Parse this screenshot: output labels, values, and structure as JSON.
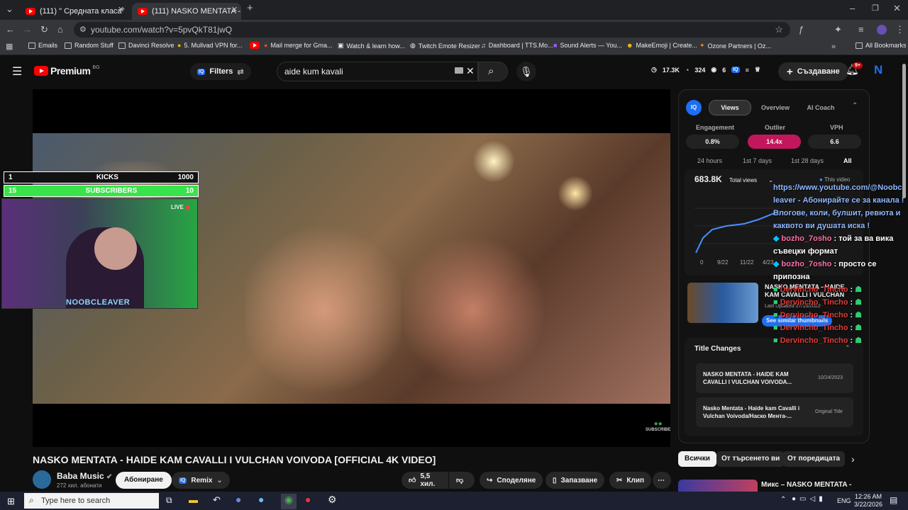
{
  "tabs": [
    {
      "label": "(111) \" Средната класа\" в Бълг"
    },
    {
      "label": "(111) NASKO MENTATA - Ha"
    }
  ],
  "address": {
    "url": "youtube.com/watch?v=5pvQkT81jwQ"
  },
  "bookmarks": [
    "Emails",
    "Random Stuff",
    "Davinci Resolve",
    "5. Mullvad VPN for...",
    "Mail merge for Gma...",
    "Watch & learn how...",
    "Twitch Emote Resizer",
    "Dashboard | TTS.Mo...",
    "Sound Alerts — You...",
    "MakeEmoji | Create...",
    "Ozone Partners | Oz...",
    "All Bookmarks"
  ],
  "yt": {
    "logo": "Premium",
    "region": "BG",
    "filters": "Filters",
    "search_value": "aide kum kavali",
    "stats": {
      "views": "17.3K",
      "likes": "324",
      "count": "6"
    },
    "create": "Създаване",
    "notif": "9+",
    "avatar_letter": "N"
  },
  "overlay": {
    "kicks_count": "1",
    "kicks_label": "KICKS",
    "kicks_goal": "1000",
    "subs_count": "15",
    "subs_label": "SUBSCRIBERS",
    "subs_goal": "10",
    "subs_progress": 1.0,
    "live": "LIVE",
    "streamer": "NOOBCLEAVER",
    "subscribe": "SUBSCRIBE"
  },
  "vidiq": {
    "tabs": [
      "Views",
      "Overview",
      "AI Coach"
    ],
    "metrics": [
      {
        "label": "Engagement",
        "value": "0.8%"
      },
      {
        "label": "Outlier",
        "value": "14.4x"
      },
      {
        "label": "VPH",
        "value": "6.6"
      }
    ],
    "ranges": [
      "24 hours",
      "1st 7 days",
      "1st 28 days",
      "All"
    ],
    "total": "683.8K",
    "total_select": "Total views",
    "this_video": "This video",
    "xticks": [
      "0",
      "9/22",
      "11/22",
      "4/23"
    ],
    "thumb_title": "NASKO MENTATA - HAIDE KAM CAVALLI I VULCHAN",
    "last_updated": "Last Updated 07/19/2022",
    "see_similar": "See similar thumbnails",
    "title_changes": "Title Changes",
    "changes": [
      {
        "title": "NASKO MENTATA - HAIDE KAM CAVALLI I VULCHAN VOIVODA...",
        "meta": "10/24/2023"
      },
      {
        "title": "Nasko Mentata - Haide kam Cavalli i Vulchan Voivoda/Наско Мента-...",
        "meta": "Original Title"
      }
    ]
  },
  "chat": [
    {
      "user": "",
      "text": "https://www.youtube.com/@Noobc leaver - Абонирайте се за канала ! Влогове, коли, булшит, ревюта и каквото ви душата иска !"
    },
    {
      "user": "bozho_7osho",
      "text": ": той за ва вика съвецки формат"
    },
    {
      "user": "bozho_7osho",
      "text": ": просто се припозна"
    },
    {
      "user": "Dervincho_Tincho",
      "text": ":"
    },
    {
      "user": "Dervincho_Tincho",
      "text": ":"
    },
    {
      "user": "Dervincho_Tincho",
      "text": ":"
    },
    {
      "user": "Dervincho_Tincho",
      "text": ":"
    },
    {
      "user": "Dervincho_Tincho",
      "text": ":"
    }
  ],
  "video": {
    "title": "NASKO MENTATA - HAIDE KAM CAVALLI I VULCHAN VOIVODA [OFFICIAL 4K VIDEO]",
    "channel": "Baba Music",
    "subs": "272 хил. абонати",
    "subscribe": "Абониране",
    "remix": "Remix",
    "likes": "5,5 хил.",
    "share": "Споделяне",
    "save": "Запазване",
    "clip": "Клип"
  },
  "chips": [
    "Всички",
    "От търсенето ви",
    "От поредицата"
  ],
  "next_title": "Микс – NASKO MENTATA -",
  "taskbar": {
    "search": "Type here to search",
    "lang": "ENG",
    "time": "12:26 AM",
    "date": "3/22/2026"
  },
  "colors": {
    "accent_red": "#ff0000",
    "outlier_pink": "#c2185b",
    "vidiq_blue": "#1e6ff1",
    "chat_user_blue": "#ff6fa8",
    "chat_user_red": "#e53935"
  }
}
